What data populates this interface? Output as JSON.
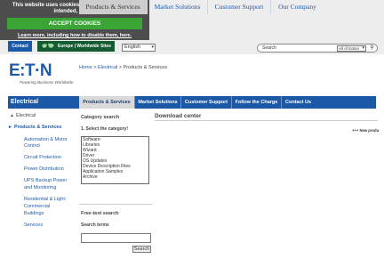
{
  "cookie": {
    "message": "This website uses cookies. To use the website as intended, please",
    "accept_label": "ACCEPT COOKIES",
    "learn_more": "Learn more, including how to disable them, here."
  },
  "header": {
    "contact_label": "Contact",
    "region_label": "Europe | Worldwide Sites",
    "language": "English",
    "search_placeholder": "Search",
    "search_scope": "All of Eaton"
  },
  "brand": {
    "logo_text": "E:T·N",
    "tagline": "Powering Business Worldwide"
  },
  "breadcrumb": {
    "home": "Home",
    "sep1": ">",
    "electrical": "Electrical",
    "sep2": ">",
    "current": "Products & Services"
  },
  "top_tabs": [
    {
      "label": "Products & Services"
    },
    {
      "label": "Market Solutions"
    },
    {
      "label": "Customer Support"
    },
    {
      "label": "Our Company"
    }
  ],
  "section_label": "Electrical",
  "sub_nav": [
    {
      "label": "Products & Services"
    },
    {
      "label": "Market Solutions"
    },
    {
      "label": "Customer Support"
    },
    {
      "label": "Follow the Charge"
    },
    {
      "label": "Contact Us"
    }
  ],
  "left_nav": {
    "parent": "Electrical",
    "current": "Products & Services",
    "items": [
      "Automation & Motor",
      "Control",
      "Circuit Protection",
      "Power Distribution",
      "UPS Backup Power",
      "and Monitoring",
      "Residential & Light-",
      "Commercial",
      "Buildings",
      "Services"
    ]
  },
  "category_search": {
    "title": "Category search",
    "step": "1. Select the category!",
    "options": [
      "Software",
      "Libraries",
      "Wizard",
      "Driver",
      "OS Updates",
      "Device Description Files",
      "Application Samples",
      "Archive"
    ]
  },
  "free_text": {
    "title": "Free-text search",
    "terms_label": "Search terms",
    "button": "Search"
  },
  "download": {
    "title": "Download center",
    "new_products": "+++ New produ"
  },
  "colors": {
    "brand_blue": "#1b59a7",
    "cookie_bg": "#4d4d4d",
    "accept_green": "#3aa435",
    "region_green": "#145b32"
  }
}
